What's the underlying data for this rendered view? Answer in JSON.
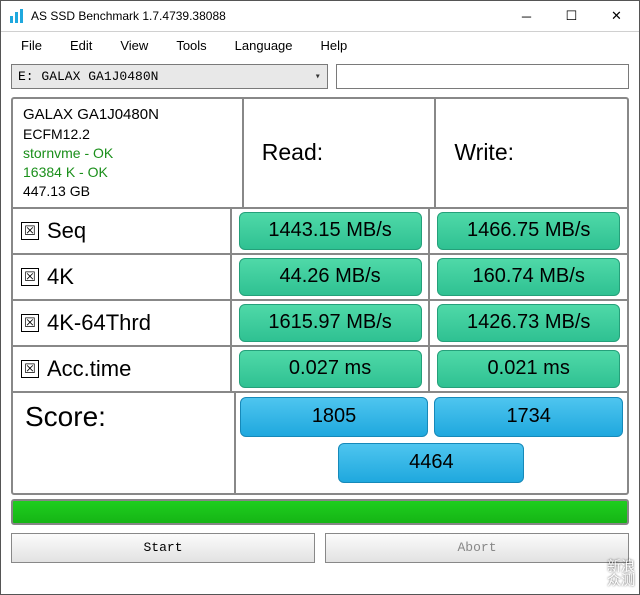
{
  "window": {
    "title": "AS SSD Benchmark 1.7.4739.38088"
  },
  "menu": {
    "file": "File",
    "edit": "Edit",
    "view": "View",
    "tools": "Tools",
    "language": "Language",
    "help": "Help"
  },
  "drive": {
    "selected": "E: GALAX GA1J0480N"
  },
  "info": {
    "model": "GALAX GA1J0480N",
    "fw": "ECFM12.2",
    "driver": "stornvme - OK",
    "align": "16384 K - OK",
    "capacity": "447.13 GB"
  },
  "columns": {
    "read": "Read:",
    "write": "Write:"
  },
  "rows": {
    "seq": {
      "label": "Seq",
      "checked": true,
      "read": "1443.15 MB/s",
      "write": "1466.75 MB/s"
    },
    "fk": {
      "label": "4K",
      "checked": true,
      "read": "44.26 MB/s",
      "write": "160.74 MB/s"
    },
    "fk64": {
      "label": "4K-64Thrd",
      "checked": true,
      "read": "1615.97 MB/s",
      "write": "1426.73 MB/s"
    },
    "acc": {
      "label": "Acc.time",
      "checked": true,
      "read": "0.027 ms",
      "write": "0.021 ms"
    }
  },
  "score": {
    "label": "Score:",
    "read": "1805",
    "write": "1734",
    "total": "4464"
  },
  "buttons": {
    "start": "Start",
    "abort": "Abort"
  },
  "watermark": {
    "l1": "新浪",
    "l2": "众测"
  },
  "chart_data": {
    "type": "table",
    "title": "AS SSD Benchmark 1.7.4739.38088",
    "drive": "E: GALAX GA1J0480N",
    "firmware": "ECFM12.2",
    "driver": "stornvme - OK",
    "alignment": "16384 K - OK",
    "capacity_gb": 447.13,
    "columns": [
      "Read",
      "Write"
    ],
    "rows": [
      {
        "metric": "Seq",
        "read_mb_s": 1443.15,
        "write_mb_s": 1466.75
      },
      {
        "metric": "4K",
        "read_mb_s": 44.26,
        "write_mb_s": 160.74
      },
      {
        "metric": "4K-64Thrd",
        "read_mb_s": 1615.97,
        "write_mb_s": 1426.73
      },
      {
        "metric": "Acc.time",
        "read_ms": 0.027,
        "write_ms": 0.021
      }
    ],
    "score": {
      "read": 1805,
      "write": 1734,
      "total": 4464
    }
  }
}
